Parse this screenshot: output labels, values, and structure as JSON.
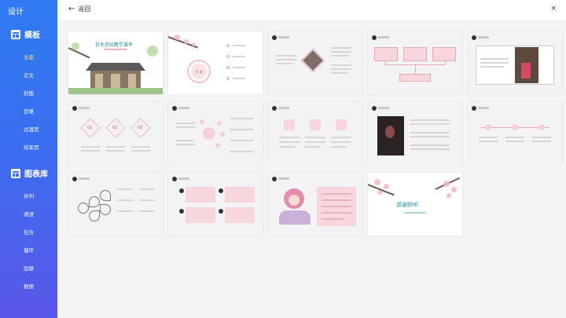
{
  "sidebar": {
    "title": "设计",
    "templates": {
      "label": "模板",
      "items": [
        "全套",
        "正文",
        "封面",
        "目录",
        "过渡页",
        "结束页"
      ],
      "active_index": 0
    },
    "charts": {
      "label": "图表库",
      "items": [
        "并列",
        "递进",
        "包含",
        "循环",
        "层级",
        "数据"
      ]
    }
  },
  "topbar": {
    "back_label": "返回",
    "close_label": "×"
  },
  "thumbnails": {
    "cover_title": "日系手绘教学课件",
    "toc_title": "目 录",
    "step_numbers": [
      "01",
      "02",
      "03"
    ],
    "end_title": "感谢聆听"
  },
  "colors": {
    "accent": "#3a72f1",
    "active_nav": "#ffe27a",
    "pink": "#f7d6dc"
  }
}
